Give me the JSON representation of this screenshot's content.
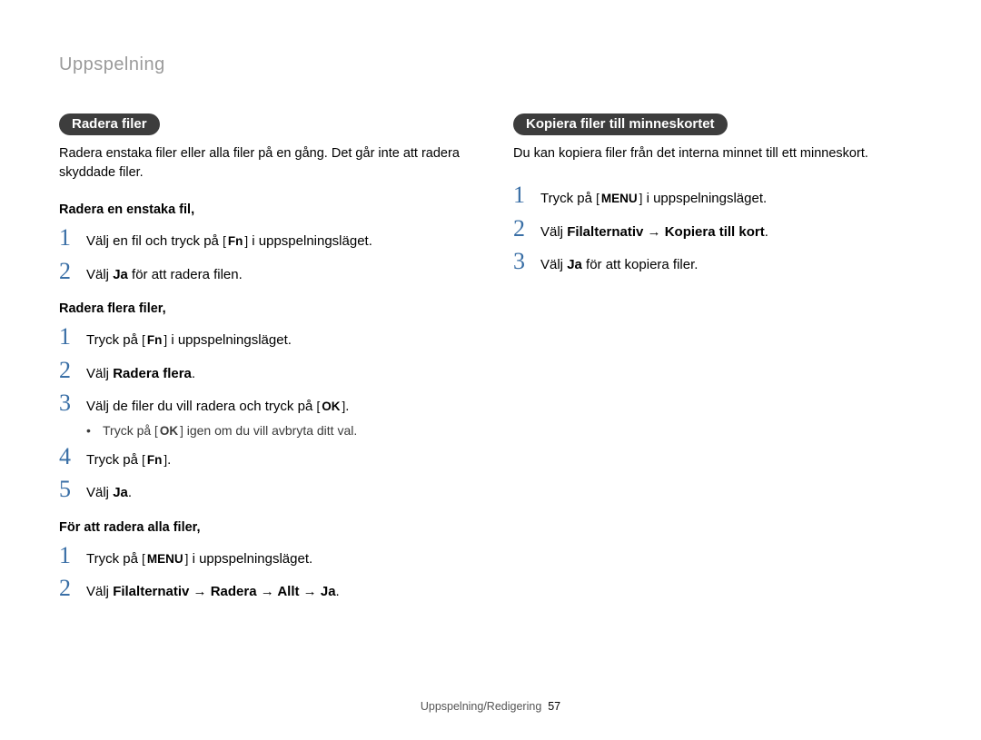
{
  "breadcrumb": "Uppspelning",
  "left": {
    "pill": "Radera filer",
    "intro": "Radera enstaka filer eller alla filer på en gång. Det går inte att radera skyddade filer.",
    "sec1_head": "Radera en enstaka fil,",
    "sec1_step1_a": "Välj en fil och tryck på ",
    "sec1_step1_key": "Fn",
    "sec1_step1_b": " i uppspelningsläget.",
    "sec1_step2_a": "Välj ",
    "sec1_step2_bold": "Ja",
    "sec1_step2_b": " för att radera filen.",
    "sec2_head": "Radera flera filer,",
    "sec2_step1_a": "Tryck på ",
    "sec2_step1_key": "Fn",
    "sec2_step1_b": " i uppspelningsläget.",
    "sec2_step2_a": "Välj ",
    "sec2_step2_bold": "Radera flera",
    "sec2_step2_b": ".",
    "sec2_step3_a": "Välj de filer du vill radera och tryck på ",
    "sec2_step3_key": "OK",
    "sec2_step3_b": ".",
    "sec2_bullet_a": "Tryck på ",
    "sec2_bullet_key": "OK",
    "sec2_bullet_b": " igen om du vill avbryta ditt val.",
    "sec2_step4_a": "Tryck på ",
    "sec2_step4_key": "Fn",
    "sec2_step4_b": ".",
    "sec2_step5_a": "Välj ",
    "sec2_step5_bold": "Ja",
    "sec2_step5_b": ".",
    "sec3_head": "För att radera alla filer,",
    "sec3_step1_a": "Tryck på ",
    "sec3_step1_key": "MENU",
    "sec3_step1_b": " i uppspelningsläget.",
    "sec3_step2_a": "Välj ",
    "sec3_step2_bold": "Filalternativ → Radera → Allt → Ja",
    "sec3_step2_b": "."
  },
  "right": {
    "pill": "Kopiera filer till minneskortet",
    "intro": "Du kan kopiera filer från det interna minnet till ett minneskort.",
    "step1_a": "Tryck på ",
    "step1_key": "MENU",
    "step1_b": " i uppspelningsläget.",
    "step2_a": "Välj ",
    "step2_bold": "Filalternativ → Kopiera till kort",
    "step2_b": ".",
    "step3_a": "Välj ",
    "step3_bold": "Ja",
    "step3_b": " för att kopiera filer."
  },
  "footer": {
    "section": "Uppspelning/Redigering",
    "page": "57"
  }
}
